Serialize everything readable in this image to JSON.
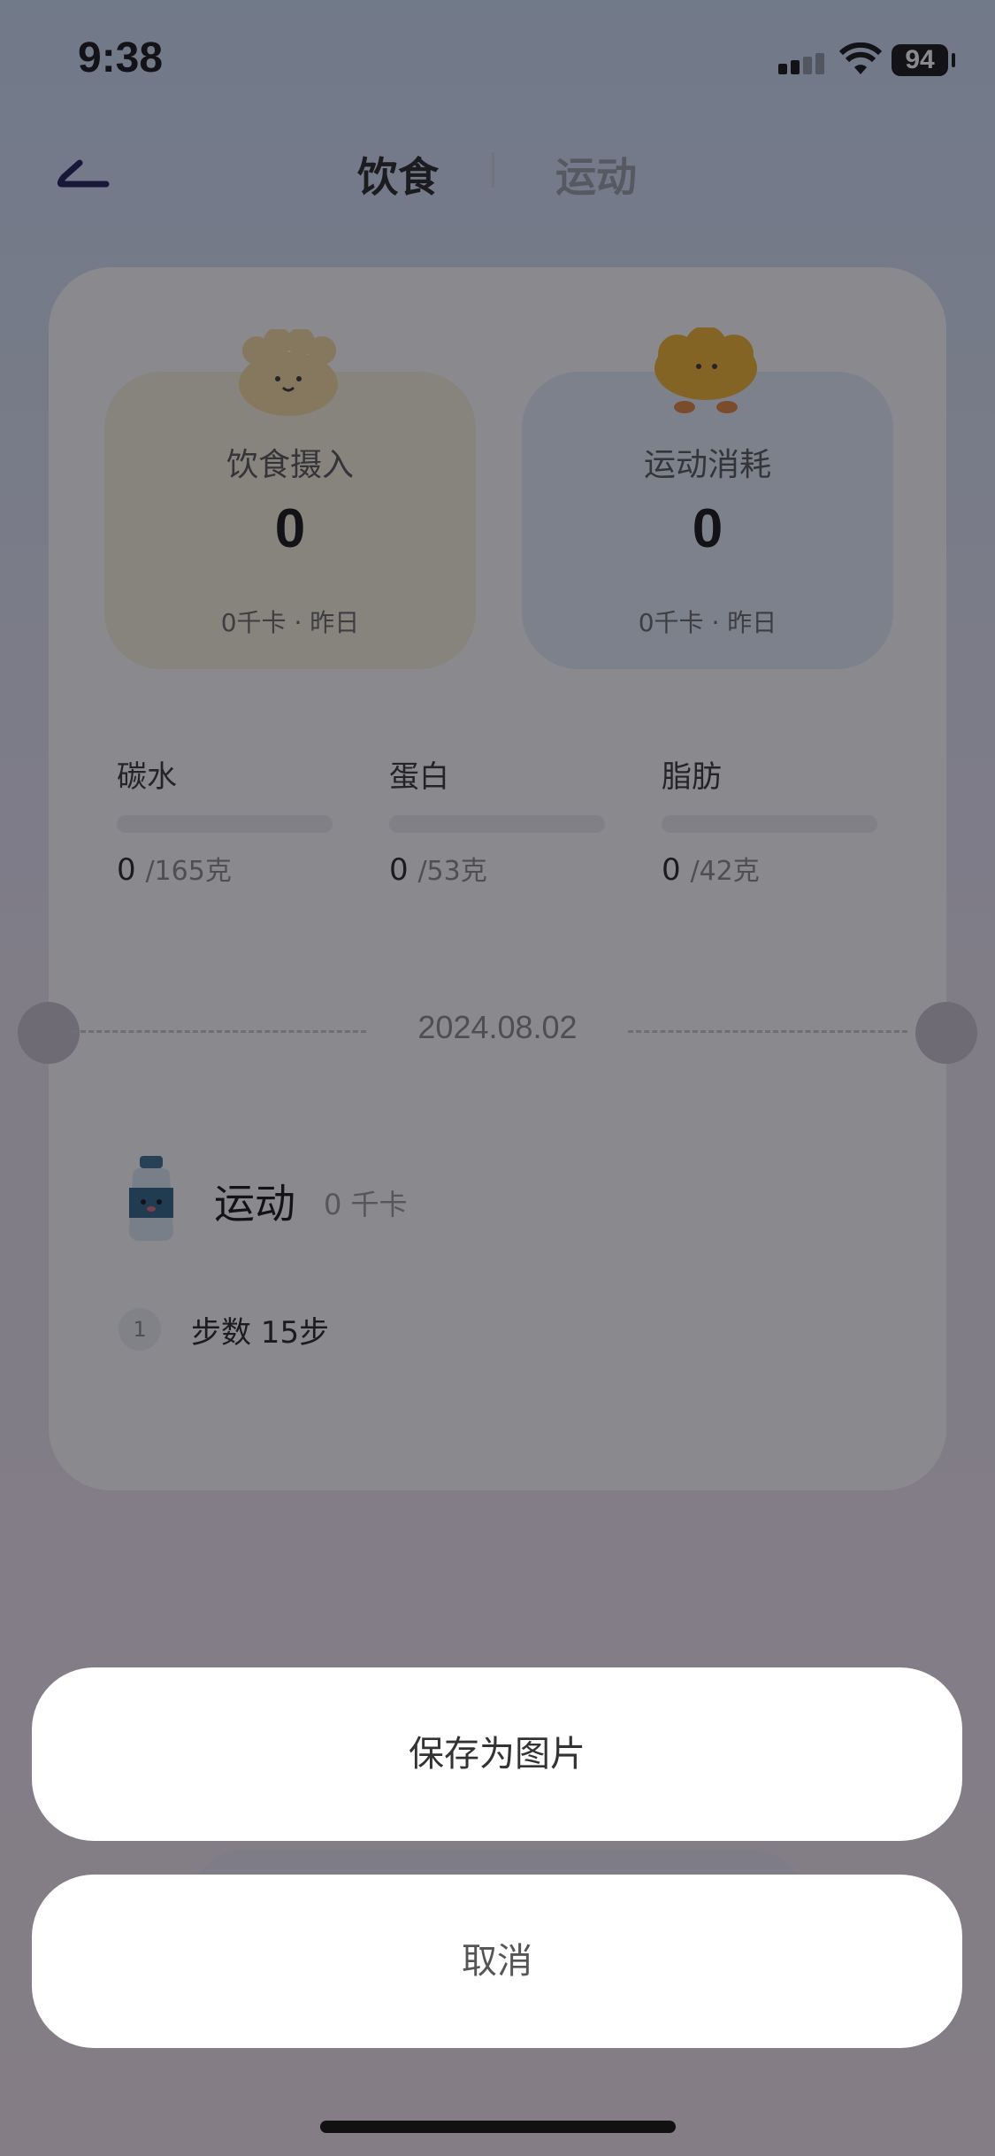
{
  "status_bar": {
    "time": "9:38",
    "battery": "94"
  },
  "header": {
    "tabs": [
      "饮食",
      "运动"
    ]
  },
  "tiles": [
    {
      "title": "饮食摄入",
      "value": "0",
      "sub": "0千卡 · 昨日"
    },
    {
      "title": "运动消耗",
      "value": "0",
      "sub": "0千卡 · 昨日"
    }
  ],
  "macros": [
    {
      "label": "碳水",
      "value": "0",
      "goal": "/165克",
      "progress": 0
    },
    {
      "label": "蛋白",
      "value": "0",
      "goal": "/53克",
      "progress": 0
    },
    {
      "label": "脂肪",
      "value": "0",
      "goal": "/42克",
      "progress": 0
    }
  ],
  "date": "2024.08.02",
  "sport_section": {
    "title": "运动",
    "kcal": "0 千卡"
  },
  "steps": [
    {
      "index": "1",
      "text": "步数 15步"
    }
  ],
  "action_sheet": {
    "save_label": "保存为图片",
    "cancel_label": "取消"
  }
}
